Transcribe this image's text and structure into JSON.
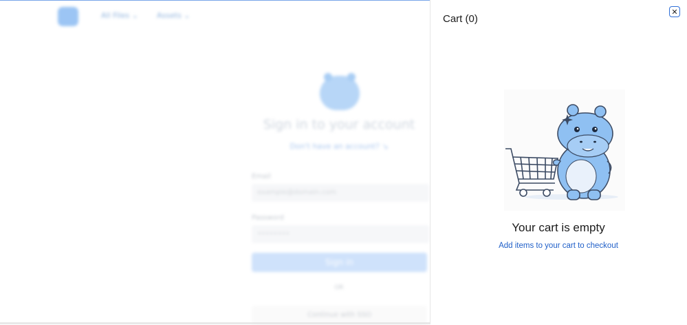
{
  "background": {
    "nav": [
      "All Files ⌄",
      "Assets ⌄"
    ],
    "title": "Sign in to your account",
    "signup_link": "Don't have an account? ↘",
    "email_label": "Email",
    "email_placeholder": "example@domain.com",
    "password_label": "Password",
    "password_placeholder": "••••••••",
    "signin_button": "Sign in",
    "divider": "OR",
    "alt_button": "Continue with SSO"
  },
  "cart": {
    "title": "Cart (0)",
    "close_icon": "close-icon",
    "empty_title": "Your cart is empty",
    "empty_link": "Add items to your cart to checkout"
  },
  "colors": {
    "accent": "#1f5fc8",
    "border_focus": "#2f6fd8",
    "hippo": "#8fc0f2"
  }
}
